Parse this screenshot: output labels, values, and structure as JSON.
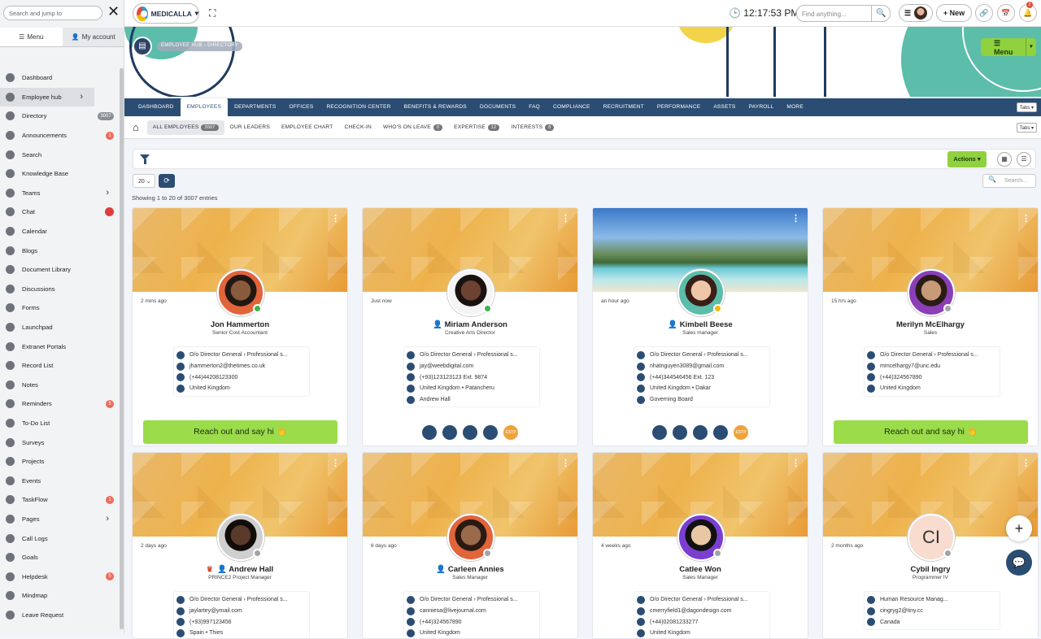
{
  "sidebar": {
    "search_placeholder": "Search and jump to",
    "close": "✕",
    "tabs": [
      {
        "label": "Menu"
      },
      {
        "label": "My account"
      }
    ],
    "items": [
      {
        "label": "Dashboard"
      },
      {
        "label": "Employee hub",
        "chevron": "›"
      },
      {
        "label": "Directory",
        "badge": "3007"
      },
      {
        "label": "Announcements",
        "badge": "1"
      },
      {
        "label": "Search"
      },
      {
        "label": "Knowledge Base"
      },
      {
        "label": "Teams",
        "chevron": "›"
      },
      {
        "label": "Chat"
      },
      {
        "label": "Calendar"
      },
      {
        "label": "Blogs"
      },
      {
        "label": "Document Library"
      },
      {
        "label": "Discussions"
      },
      {
        "label": "Forms"
      },
      {
        "label": "Launchpad"
      },
      {
        "label": "Extranet Portals"
      },
      {
        "label": "Record List"
      },
      {
        "label": "Notes"
      },
      {
        "label": "Reminders",
        "badge": "5"
      },
      {
        "label": "To-Do List"
      },
      {
        "label": "Surveys"
      },
      {
        "label": "Projects"
      },
      {
        "label": "Events"
      },
      {
        "label": "TaskFlow",
        "badge": "1"
      },
      {
        "label": "Pages",
        "chevron": "›"
      },
      {
        "label": "Call Logs"
      },
      {
        "label": "Goals"
      },
      {
        "label": "Helpdesk",
        "badge": "5"
      },
      {
        "label": "Mindmap"
      },
      {
        "label": "Leave Request"
      }
    ]
  },
  "topbar": {
    "brand": "MEDICALLA",
    "time": "12:17:53 PM",
    "find_placeholder": "Find anything...",
    "new_label": "New",
    "notif_count": "2"
  },
  "banner": {
    "breadcrumb": "EMPLOYEE HUB  ›  DIRECTORY",
    "menu_label": "Menu"
  },
  "main_nav": {
    "items": [
      "DASHBOARD",
      "EMPLOYEES",
      "DEPARTMENTS",
      "OFFICES",
      "RECOGNITION CENTER",
      "BENEFITS & REWARDS",
      "DOCUMENTS",
      "FAQ",
      "COMPLIANCE",
      "RECRUITMENT",
      "PERFORMANCE",
      "ASSETS",
      "PAYROLL",
      "MORE"
    ],
    "active": "EMPLOYEES",
    "tabs_label": "Tabs"
  },
  "sub_nav": {
    "items": [
      {
        "label": "ALL EMPLOYEES",
        "badge": "3007"
      },
      {
        "label": "OUR LEADERS"
      },
      {
        "label": "EMPLOYEE CHART"
      },
      {
        "label": "CHECK-IN"
      },
      {
        "label": "WHO'S ON LEAVE",
        "badge": "0"
      },
      {
        "label": "EXPERTISE",
        "badge": "12"
      },
      {
        "label": "INTERESTS",
        "badge": "8"
      }
    ],
    "tabs_label": "Tabs"
  },
  "toolbar": {
    "actions_label": "Actions",
    "page_size": "20",
    "showing": "Showing 1 to 20 of 3007 entries",
    "search_placeholder": "Search..."
  },
  "reach_label": "Reach out and say hi 👋",
  "cards": [
    {
      "ago": "2 mins ago",
      "name": "Jon Hammerton",
      "title": "Senior Cost Accountant",
      "rows": [
        "O/o Director General   ›   Professional s...",
        "jhammerton2@thetimes.co.uk",
        "(+44)44208123300",
        "United Kingdom"
      ],
      "status": "#3cb54a"
    },
    {
      "ago": "Just now",
      "name": "Miriam Anderson",
      "title": "Creative Arts Director",
      "rows": [
        "O/o Director General   ›   Professional s...",
        "jay@weebdigital.com",
        "(+93)123123123 Ext. 9874",
        "United Kingdom  •  Patancheru",
        "Andrew Hall"
      ],
      "status": "#3cb54a"
    },
    {
      "ago": "an hour ago",
      "name": "Kimbell Beese",
      "title": "Sales manager",
      "rows": [
        "O/o Director General   ›   Professional s...",
        "nhatnguyen3089@gmail.com",
        "(+44)344546456 Ext. 123",
        "United Kingdom  •  Dakar",
        "Governing Board"
      ],
      "status": "#f2b705"
    },
    {
      "ago": "15 hrs ago",
      "name": "Merilyn McElhargy",
      "title": "Sales",
      "rows": [
        "O/o Director General   ›   Professional s...",
        "mmcelhargy7@unc.edu",
        "(+44)324567890",
        "United Kingdom"
      ],
      "status": "#a0a4aa"
    },
    {
      "ago": "2 days ago",
      "name": "Andrew Hall",
      "title": "PRINCE2 Project Manager",
      "rows": [
        "O/o Director General   ›   Professional s...",
        "jaylartey@ymail.com",
        "(+93)997123456",
        "Spain  •  Thies"
      ],
      "status": "#a0a4aa"
    },
    {
      "ago": "6 days ago",
      "name": "Carleen Annies",
      "title": "Sales Manager",
      "rows": [
        "O/o Director General   ›   Professional s...",
        "canniesa@livejournal.com",
        "(+44)324567890",
        "United Kingdom"
      ],
      "status": "#a0a4aa"
    },
    {
      "ago": "4 weeks ago",
      "name": "Catlee Won",
      "title": "Sales Manager",
      "rows": [
        "O/o Director General   ›   Professional s...",
        "cmerryfield1@dagondesign.com",
        "(+44)02081233277",
        "United Kingdom"
      ],
      "status": "#a0a4aa"
    },
    {
      "ago": "2 months ago",
      "name": "Cybil Ingry",
      "title": "Programmer IV",
      "initials": "CI",
      "rows": [
        "Human Resource Manag...",
        "cingryg2@tiny.cc",
        "Canada"
      ],
      "status": "#a0a4aa"
    }
  ],
  "badge_label": "ESTP"
}
